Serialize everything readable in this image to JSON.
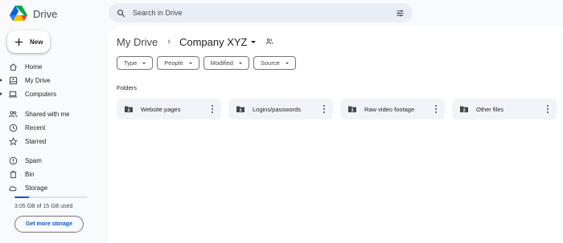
{
  "app": {
    "title": "Drive"
  },
  "search": {
    "placeholder": "Search in Drive"
  },
  "sidebar": {
    "new_label": "New",
    "items": [
      {
        "label": "Home",
        "icon": "home-icon"
      },
      {
        "label": "My Drive",
        "icon": "drive-icon"
      },
      {
        "label": "Computers",
        "icon": "computer-icon"
      },
      {
        "label": "Shared with me",
        "icon": "people-icon"
      },
      {
        "label": "Recent",
        "icon": "clock-icon"
      },
      {
        "label": "Starred",
        "icon": "star-icon"
      },
      {
        "label": "Spam",
        "icon": "spam-icon"
      },
      {
        "label": "Bin",
        "icon": "trash-icon"
      },
      {
        "label": "Storage",
        "icon": "cloud-icon"
      }
    ],
    "storage": {
      "used_text": "3.05 GB of 15 GB used",
      "used_fraction": 0.2
    },
    "get_storage_label": "Get more storage"
  },
  "breadcrumb": {
    "root": "My Drive",
    "separator": "›",
    "current": "Company XYZ"
  },
  "filters": [
    {
      "label": "Type"
    },
    {
      "label": "People"
    },
    {
      "label": "Modified"
    },
    {
      "label": "Source"
    }
  ],
  "folders": {
    "heading": "Folders",
    "items": [
      {
        "name": "Website pages"
      },
      {
        "name": "Logins/passwords"
      },
      {
        "name": "Raw video footage"
      },
      {
        "name": "Other files"
      }
    ]
  },
  "colors": {
    "accent": "#0b57d0",
    "background": "#f8fafd",
    "surface": "#ffffff",
    "folder_bg": "#f0f4f9"
  }
}
